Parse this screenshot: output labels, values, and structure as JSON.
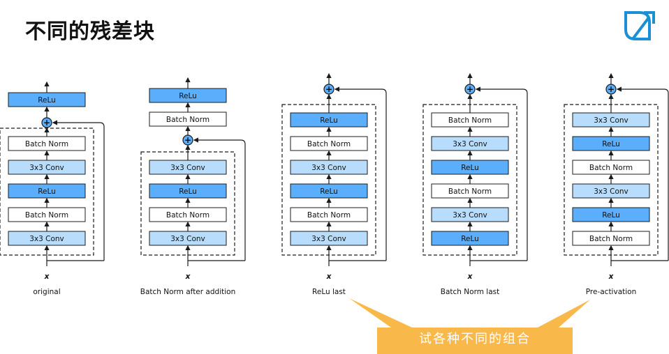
{
  "page": {
    "title": "不同的残差块",
    "callout": "试各种不同的组合"
  },
  "colors": {
    "relu": "#5aaefc",
    "conv": "#b8dcfb",
    "norm": "#ffffff",
    "stroke": "#1b1b1b",
    "callout": "#f9b84a",
    "logo": "#1a8fd6"
  },
  "variants": [
    {
      "name": "original",
      "caption": "original",
      "x_label": "x",
      "top_block": {
        "label": "ReLu",
        "kind": "relu"
      },
      "mid_block": null,
      "blocks": [
        {
          "label": "Batch Norm",
          "kind": "norm"
        },
        {
          "label": "3x3 Conv",
          "kind": "conv"
        },
        {
          "label": "ReLu",
          "kind": "relu"
        },
        {
          "label": "Batch Norm",
          "kind": "norm"
        },
        {
          "label": "3x3 Conv",
          "kind": "conv"
        }
      ],
      "add_symbol": "+"
    },
    {
      "name": "batch-norm-after-addition",
      "caption": "Batch Norm after addition",
      "x_label": "x",
      "top_block": {
        "label": "ReLu",
        "kind": "relu"
      },
      "mid_block": {
        "label": "Batch Norm",
        "kind": "norm"
      },
      "blocks": [
        {
          "label": "3x3 Conv",
          "kind": "conv"
        },
        {
          "label": "ReLu",
          "kind": "relu"
        },
        {
          "label": "Batch Norm",
          "kind": "norm"
        },
        {
          "label": "3x3 Conv",
          "kind": "conv"
        }
      ],
      "add_symbol": "+"
    },
    {
      "name": "relu-last",
      "caption": "ReLu last",
      "x_label": "x",
      "top_block": null,
      "mid_block": null,
      "blocks": [
        {
          "label": "ReLu",
          "kind": "relu"
        },
        {
          "label": "Batch Norm",
          "kind": "norm"
        },
        {
          "label": "3x3 Conv",
          "kind": "conv"
        },
        {
          "label": "ReLu",
          "kind": "relu"
        },
        {
          "label": "Batch Norm",
          "kind": "norm"
        },
        {
          "label": "3x3 Conv",
          "kind": "conv"
        }
      ],
      "add_symbol": "+"
    },
    {
      "name": "batch-norm-last",
      "caption": "Batch Norm last",
      "x_label": "x",
      "top_block": null,
      "mid_block": null,
      "blocks": [
        {
          "label": "Batch Norm",
          "kind": "norm"
        },
        {
          "label": "3x3 Conv",
          "kind": "conv"
        },
        {
          "label": "ReLu",
          "kind": "relu"
        },
        {
          "label": "Batch Norm",
          "kind": "norm"
        },
        {
          "label": "3x3 Conv",
          "kind": "conv"
        },
        {
          "label": "ReLu",
          "kind": "relu"
        }
      ],
      "add_symbol": "+"
    },
    {
      "name": "pre-activation",
      "caption": "Pre-activation",
      "x_label": "x",
      "top_block": null,
      "mid_block": null,
      "blocks": [
        {
          "label": "3x3 Conv",
          "kind": "conv"
        },
        {
          "label": "ReLu",
          "kind": "relu"
        },
        {
          "label": "Batch Norm",
          "kind": "norm"
        },
        {
          "label": "3x3 Conv",
          "kind": "conv"
        },
        {
          "label": "ReLu",
          "kind": "relu"
        },
        {
          "label": "Batch Norm",
          "kind": "norm"
        }
      ],
      "add_symbol": "+"
    }
  ]
}
